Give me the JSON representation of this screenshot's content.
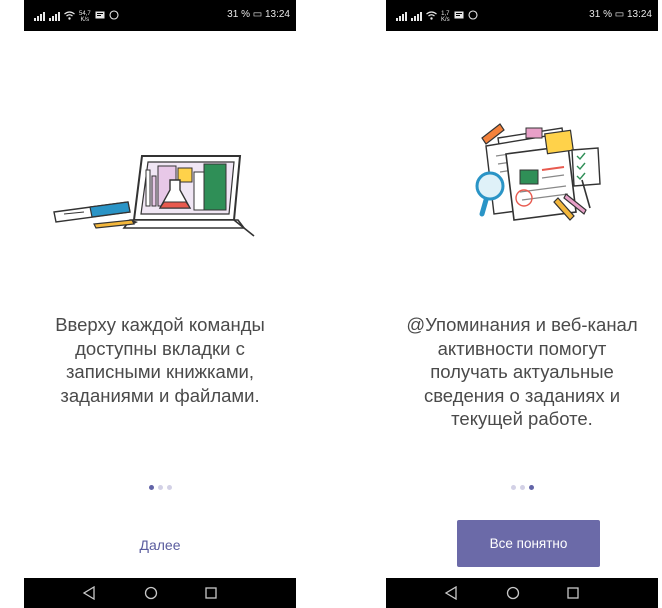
{
  "left": {
    "status": {
      "speed_value": "54,7",
      "speed_unit": "K/s",
      "time_battery": "31 % ▭ 13:24"
    },
    "message": "Вверху каждой команды доступны вкладки с записными книжками, заданиями и файлами.",
    "pager": {
      "total": 3,
      "active": 1
    },
    "next_label": "Далее"
  },
  "right": {
    "status": {
      "speed_value": "1,7",
      "speed_unit": "K/s",
      "time_battery": "31 % ▭ 13:24"
    },
    "message": "@Упоминания и веб-канал активности помогут получать актуальные сведения о заданиях и текущей работе.",
    "pager": {
      "total": 3,
      "active": 3
    },
    "button_label": "Все понятно"
  },
  "navbar": {
    "icons": [
      "back-triangle-icon",
      "home-circle-icon",
      "recents-square-icon"
    ]
  },
  "colors": {
    "accent": "#6264a7",
    "button": "#6b6aa8",
    "text": "#4a4a4a",
    "dot_inactive": "#d3d1e6"
  }
}
